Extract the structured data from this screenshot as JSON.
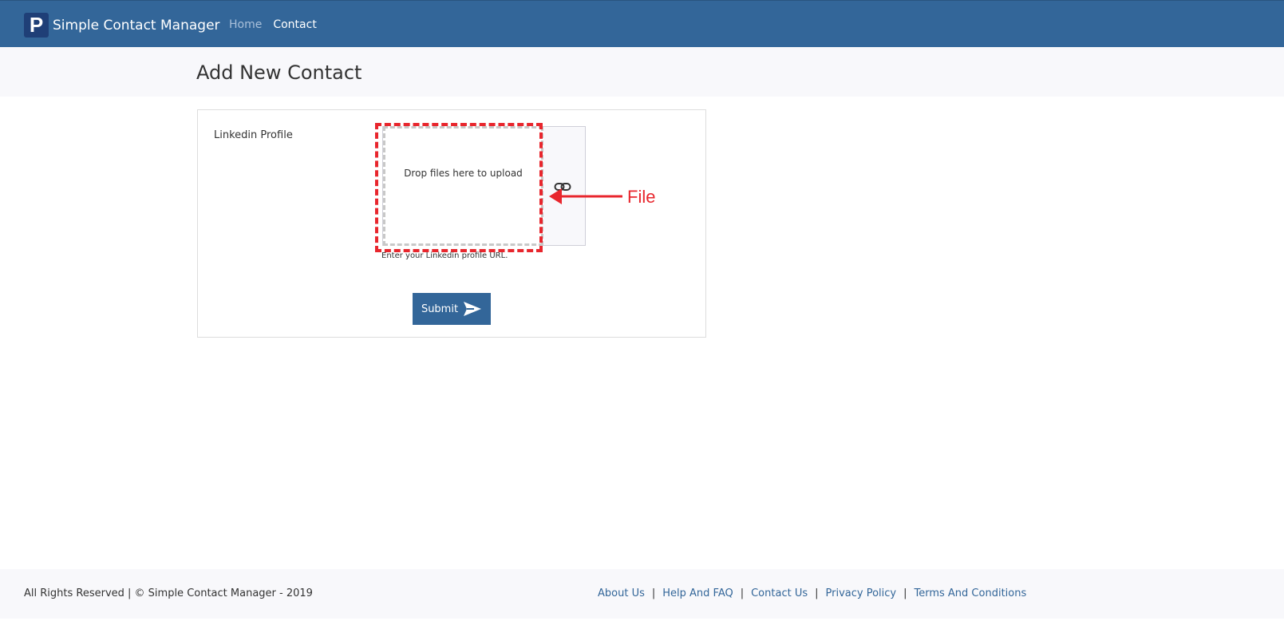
{
  "navbar": {
    "logo_letter": "P",
    "brand": "Simple Contact Manager",
    "links": [
      {
        "label": "Home",
        "active": false
      },
      {
        "label": "Contact",
        "active": true
      }
    ]
  },
  "page": {
    "title": "Add New Contact"
  },
  "form": {
    "field_label": "Linkedin Profile",
    "dropzone_text": "Drop files here to upload",
    "help_text": "Enter your Linkedin profile URL.",
    "submit_label": "Submit",
    "link_icon": "link-icon",
    "submit_icon": "send-icon"
  },
  "annotation": {
    "label": "File",
    "color": "#e8262d"
  },
  "footer": {
    "copyright": "All Rights Reserved | © Simple Contact Manager - 2019",
    "links": [
      "About Us",
      "Help And FAQ",
      "Contact Us",
      "Privacy Policy",
      "Terms And Conditions"
    ]
  },
  "colors": {
    "primary": "#336699",
    "background_band": "#f8f8fb",
    "annotation": "#e8262d"
  }
}
